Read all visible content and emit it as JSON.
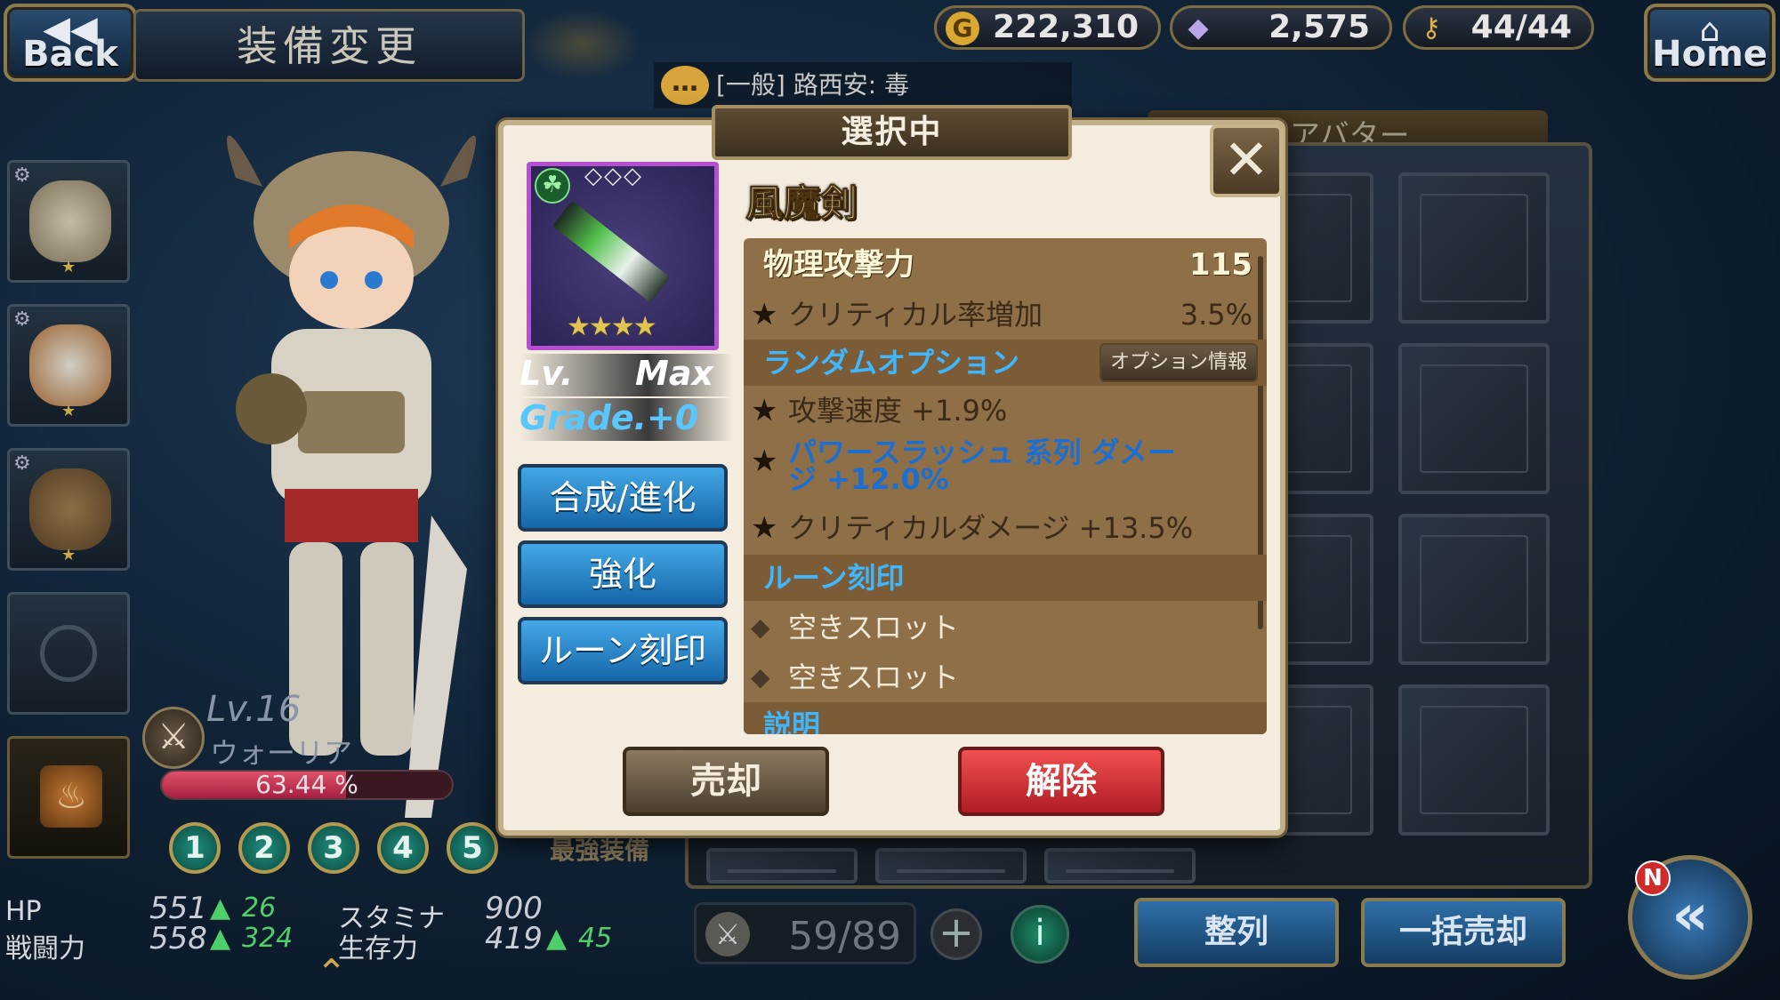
{
  "header": {
    "back_label": "Back",
    "title": "装備変更",
    "home_label": "Home",
    "gold": "222,310",
    "gems": "2,575",
    "stamina": "44/44",
    "chat": "[一般] 路西安: 毒"
  },
  "character": {
    "level": "Lv.16",
    "class_name": "ウォーリア",
    "exp_percent": "63.44 %",
    "exp_fraction": 0.6344,
    "presets": [
      "1",
      "2",
      "3",
      "4",
      "5"
    ],
    "best_equip_label": "最強装備"
  },
  "stats": {
    "hp_label": "HP",
    "hp_value": "551",
    "hp_up": "26",
    "stamina_label": "スタミナ",
    "stamina_value": "900",
    "power_label": "戦闘力",
    "power_value": "558",
    "power_up": "324",
    "survival_label": "生存力",
    "survival_value": "419",
    "survival_up": "45"
  },
  "inventory": {
    "tab_avatar": "アバター",
    "capacity": "59/89",
    "sort_label": "整列",
    "bulk_sell_label": "一括売却",
    "notif_badge": "N"
  },
  "modal": {
    "title": "選択中",
    "item_name": "風魔剣",
    "level_prefix": "Lv.",
    "level_value": "Max",
    "grade": "Grade.+0",
    "star_count": 4,
    "actions": {
      "synth": "合成/進化",
      "enhance": "強化",
      "rune": "ルーン刻印"
    },
    "main_stat_label": "物理攻撃力",
    "main_stat_value": "115",
    "sub_stat_label": "クリティカル率増加",
    "sub_stat_value": "3.5%",
    "random_header": "ランダムオプション",
    "option_info_label": "オプション情報",
    "random_options": [
      "攻撃速度 +1.9%",
      "パワースラッシュ 系列 ダメージ +12.0%",
      "クリティカルダメージ +13.5%"
    ],
    "rune_header": "ルーン刻印",
    "rune_slots": [
      "空きスロット",
      "空きスロット"
    ],
    "desc_header": "説明",
    "sell_label": "売却",
    "release_label": "解除"
  }
}
